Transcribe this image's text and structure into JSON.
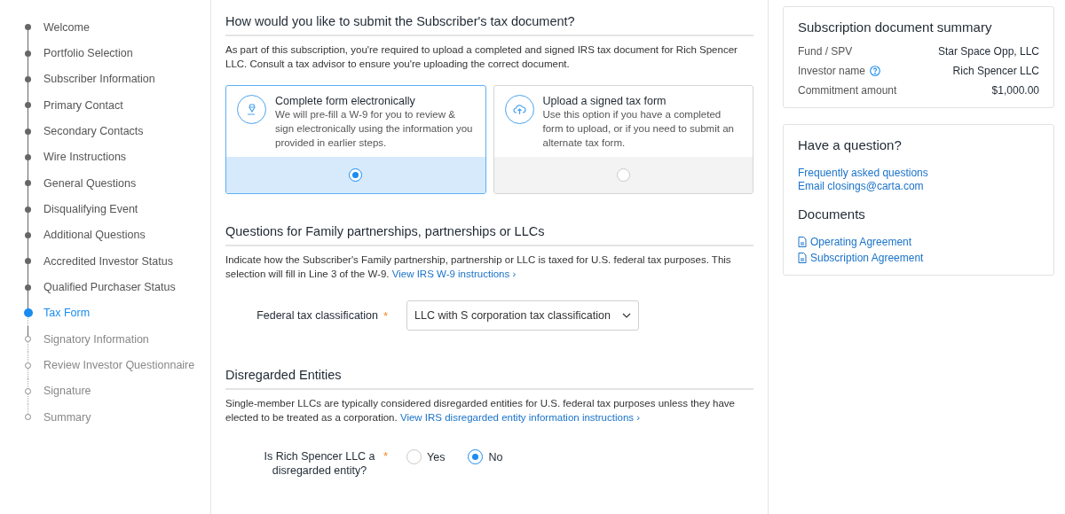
{
  "steps": [
    {
      "label": "Welcome",
      "completed": true,
      "selected": false
    },
    {
      "label": "Portfolio Selection",
      "completed": true,
      "selected": false
    },
    {
      "label": "Subscriber Information",
      "completed": true,
      "selected": false
    },
    {
      "label": "Primary Contact",
      "completed": true,
      "selected": false
    },
    {
      "label": "Secondary Contacts",
      "completed": true,
      "selected": false
    },
    {
      "label": "Wire Instructions",
      "completed": true,
      "selected": false
    },
    {
      "label": "General Questions",
      "completed": true,
      "selected": false
    },
    {
      "label": "Disqualifying Event",
      "completed": true,
      "selected": false
    },
    {
      "label": "Additional Questions",
      "completed": true,
      "selected": false
    },
    {
      "label": "Accredited Investor Status",
      "completed": true,
      "selected": false
    },
    {
      "label": "Qualified Purchaser Status",
      "completed": true,
      "selected": false
    },
    {
      "label": "Tax Form",
      "completed": false,
      "selected": true
    },
    {
      "label": "Signatory Information",
      "completed": false,
      "selected": false
    },
    {
      "label": "Review Investor Questionnaire",
      "completed": false,
      "selected": false
    },
    {
      "label": "Signature",
      "completed": false,
      "selected": false
    },
    {
      "label": "Summary",
      "completed": false,
      "selected": false
    }
  ],
  "submit_section": {
    "title": "How would you like to submit the Subscriber's tax document?",
    "description": "As part of this subscription, you're required to upload a completed and signed IRS tax document for Rich Spencer LLC. Consult a tax advisor to ensure you're uploading the correct document.",
    "options": [
      {
        "kind": "pen",
        "title": "Complete form electronically",
        "description": "We will pre-fill a W-9 for you to review & sign electronically using the information you provided in earlier steps.",
        "selected": true
      },
      {
        "kind": "upload",
        "title": "Upload a signed tax form",
        "description": "Use this option if you have a completed form to upload, or if you need to submit an alternate tax form.",
        "selected": false
      }
    ]
  },
  "classification_section": {
    "title": "Questions for Family partnerships, partnerships or LLCs",
    "description": "Indicate how the Subscriber's Family partnership, partnership or LLC is taxed for U.S. federal tax purposes. This selection will fill in Line 3 of the W-9.",
    "link": "View IRS W-9 instructions ›",
    "field_label": "Federal tax classification",
    "required_mark": "*",
    "value": "LLC with S corporation tax classification"
  },
  "disregarded_section": {
    "title": "Disregarded Entities",
    "description": "Single-member LLCs are typically considered disregarded entities for U.S. federal tax purposes unless they have elected to be treated as a corporation.",
    "link": "View IRS disregarded entity information instructions ›",
    "question": "Is Rich Spencer LLC a disregarded entity?",
    "required_mark": "*",
    "choices": [
      {
        "label": "Yes",
        "selected": false
      },
      {
        "label": "No",
        "selected": true
      }
    ]
  },
  "summary": {
    "title": "Subscription document summary",
    "rows": [
      {
        "label": "Fund / SPV",
        "value": "Star Space Opp, LLC",
        "help": false
      },
      {
        "label": "Investor name",
        "value": "Rich Spencer LLC",
        "help": true
      },
      {
        "label": "Commitment amount",
        "value": "$1,000.00",
        "help": false
      }
    ]
  },
  "help": {
    "title": "Have a question?",
    "links": [
      "Frequently asked questions",
      "Email closings@carta.com"
    ],
    "documents_title": "Documents",
    "documents": [
      "Operating Agreement",
      "Subscription Agreement"
    ]
  }
}
